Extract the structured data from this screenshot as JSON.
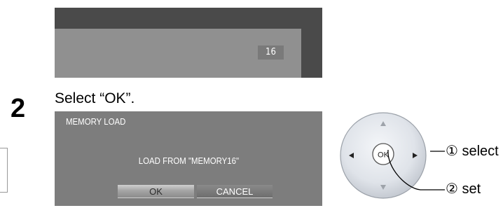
{
  "top_screen": {
    "value_box": "16"
  },
  "step": {
    "number": "2",
    "instruction": "Select “OK”."
  },
  "dialog": {
    "title": "MEMORY LOAD",
    "message": "LOAD FROM \"MEMORY16\"",
    "ok_label": "OK",
    "cancel_label": "CANCEL"
  },
  "remote": {
    "center_label": "OK",
    "callout_select": "① select",
    "callout_set": "② set"
  },
  "colors": {
    "screen_dark": "#4a4a4a",
    "screen_light": "#909090",
    "dialog_bg": "#7d7d7d",
    "pad_fill": "#d9dde4"
  },
  "icons": [
    "arrow-up-icon",
    "arrow-down-icon",
    "arrow-left-icon",
    "arrow-right-icon"
  ]
}
